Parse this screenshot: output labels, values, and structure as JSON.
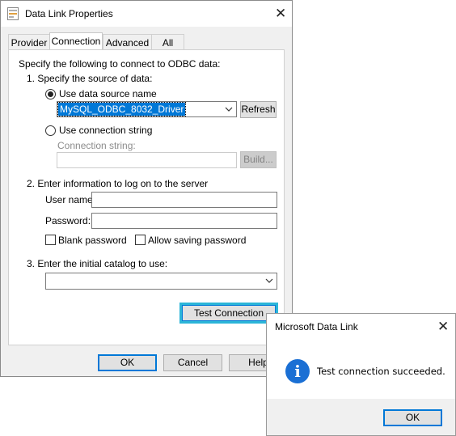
{
  "dialog": {
    "title": "Data Link Properties",
    "tabs": [
      {
        "label": "Provider"
      },
      {
        "label": "Connection"
      },
      {
        "label": "Advanced"
      },
      {
        "label": "All"
      }
    ],
    "active_tab": "Connection",
    "intro": "Specify the following to connect to ODBC data:",
    "step1": {
      "label": "1. Specify the source of data:",
      "use_dsn_label": "Use data source name",
      "use_dsn_selected": true,
      "dsn_value": "MySQL_ODBC_8032_Driver",
      "refresh_label": "Refresh",
      "use_connstr_label": "Use connection string",
      "use_connstr_selected": false,
      "connstr_label": "Connection string:",
      "connstr_value": "",
      "build_label": "Build..."
    },
    "step2": {
      "label": "2. Enter information to log on to the server",
      "username_label": "User name:",
      "username_value": "",
      "password_label": "Password:",
      "password_value": "",
      "blank_password_label": "Blank password",
      "blank_password_checked": false,
      "allow_saving_label": "Allow saving password",
      "allow_saving_checked": false
    },
    "step3": {
      "label": "3. Enter the initial catalog to use:",
      "catalog_value": ""
    },
    "test_connection_label": "Test Connection",
    "buttons": {
      "ok": "OK",
      "cancel": "Cancel",
      "help": "Help"
    }
  },
  "message_box": {
    "title": "Microsoft Data Link",
    "icon": "info-icon",
    "text": "Test connection succeeded.",
    "ok": "OK"
  },
  "colors": {
    "accent": "#0078d7",
    "highlight_outline": "#2bb5d8",
    "info_icon": "#1a6fd4"
  }
}
